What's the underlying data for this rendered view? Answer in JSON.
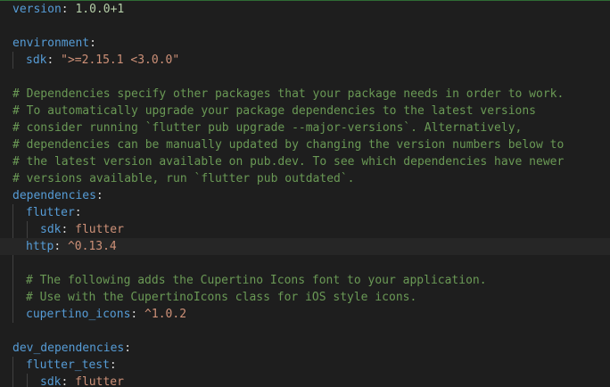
{
  "lines": [
    {
      "key": "version",
      "colon": ":",
      "value": " 1.0.0+1"
    },
    {},
    {
      "key": "environment",
      "colon": ":"
    },
    {
      "key": "sdk",
      "colon": ":",
      "value": " \">=2.15.1 <3.0.0\""
    },
    {},
    {
      "comment": "# Dependencies specify other packages that your package needs in order to work."
    },
    {
      "comment": "# To automatically upgrade your package dependencies to the latest versions"
    },
    {
      "comment": "# consider running `flutter pub upgrade --major-versions`. Alternatively,"
    },
    {
      "comment": "# dependencies can be manually updated by changing the version numbers below to"
    },
    {
      "comment": "# the latest version available on pub.dev. To see which dependencies have newer"
    },
    {
      "comment": "# versions available, run `flutter pub outdated`."
    },
    {
      "key": "dependencies",
      "colon": ":"
    },
    {
      "key": "flutter",
      "colon": ":"
    },
    {
      "key": "sdk",
      "colon": ":",
      "value": " flutter"
    },
    {
      "key": "http",
      "colon": ":",
      "value": " ^0.13.4"
    },
    {},
    {
      "comment": "# The following adds the Cupertino Icons font to your application."
    },
    {
      "comment": "# Use with the CupertinoIcons class for iOS style icons."
    },
    {
      "key": "cupertino_icons",
      "colon": ":",
      "value": " ^1.0.2"
    },
    {},
    {
      "key": "dev_dependencies",
      "colon": ":"
    },
    {
      "key": "flutter_test",
      "colon": ":"
    },
    {
      "key": "sdk",
      "colon": ":",
      "value": " flutter"
    }
  ]
}
